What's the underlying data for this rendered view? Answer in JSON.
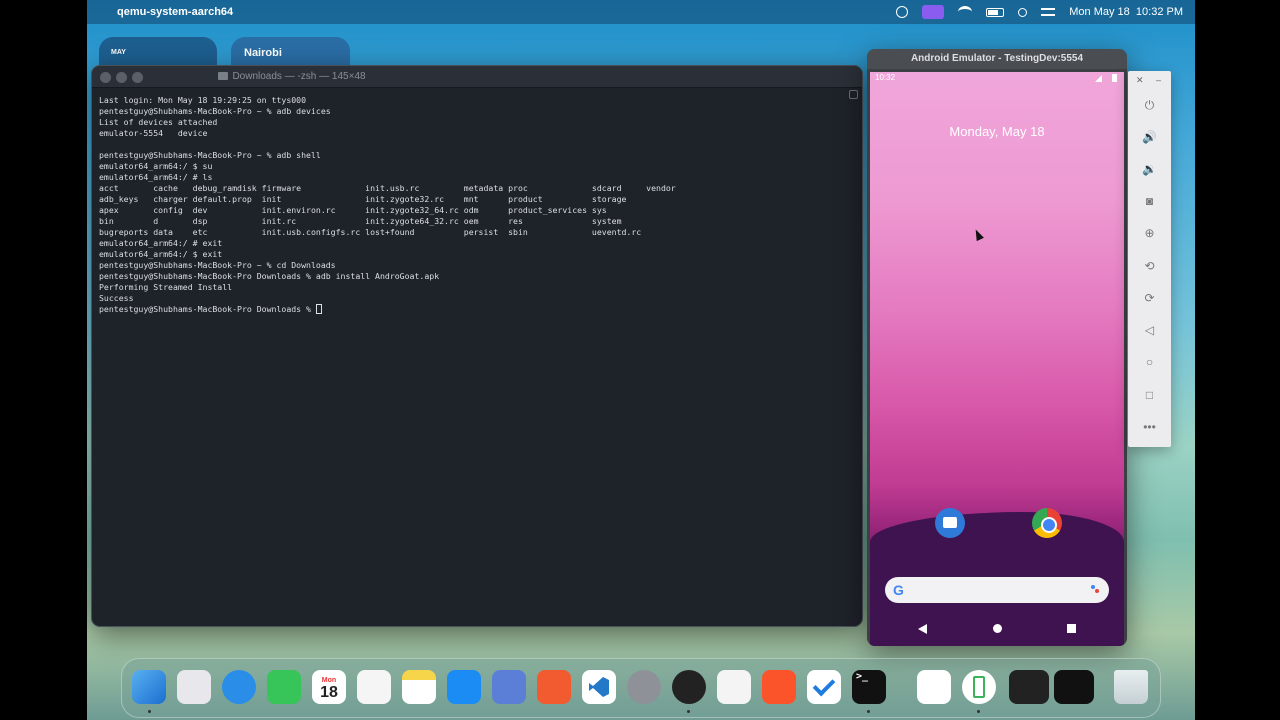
{
  "menubar": {
    "app_name": "qemu-system-aarch64",
    "datetime": "Mon May 18  10:32 PM"
  },
  "widgets": {
    "calendar_month": "MAY",
    "weather_city": "Nairobi"
  },
  "terminal": {
    "title": "Downloads — -zsh — 145×48",
    "lines": [
      "Last login: Mon May 18 19:29:25 on ttys000",
      "pentestguy@Shubhams-MacBook-Pro ~ % adb devices",
      "List of devices attached",
      "emulator-5554   device",
      "",
      "pentestguy@Shubhams-MacBook-Pro ~ % adb shell",
      "emulator64_arm64:/ $ su",
      "emulator64_arm64:/ # ls",
      "acct       cache   debug_ramdisk firmware             init.usb.rc         metadata proc             sdcard     vendor",
      "adb_keys   charger default.prop  init                 init.zygote32.rc    mnt      product          storage",
      "apex       config  dev           init.environ.rc      init.zygote32_64.rc odm      product_services sys",
      "bin        d       dsp           init.rc              init.zygote64_32.rc oem      res              system",
      "bugreports data    etc           init.usb.configfs.rc lost+found          persist  sbin             ueventd.rc",
      "emulator64_arm64:/ # exit",
      "emulator64_arm64:/ $ exit",
      "pentestguy@Shubhams-MacBook-Pro ~ % cd Downloads",
      "pentestguy@Shubhams-MacBook-Pro Downloads % adb install AndroGoat.apk",
      "Performing Streamed Install",
      "Success",
      "pentestguy@Shubhams-MacBook-Pro Downloads % "
    ]
  },
  "emulator": {
    "title": "Android Emulator - TestingDev:5554",
    "status_time": "10:32",
    "date": "Monday, May 18",
    "search_logo": "G"
  },
  "dock": {
    "calendar_month": "Mon",
    "calendar_day": "18",
    "terminal_glyph": ">_"
  },
  "colors": {
    "terminal_bg": "#1e2229",
    "phone_top": "#f0a6da",
    "phone_bottom": "#34103f"
  }
}
